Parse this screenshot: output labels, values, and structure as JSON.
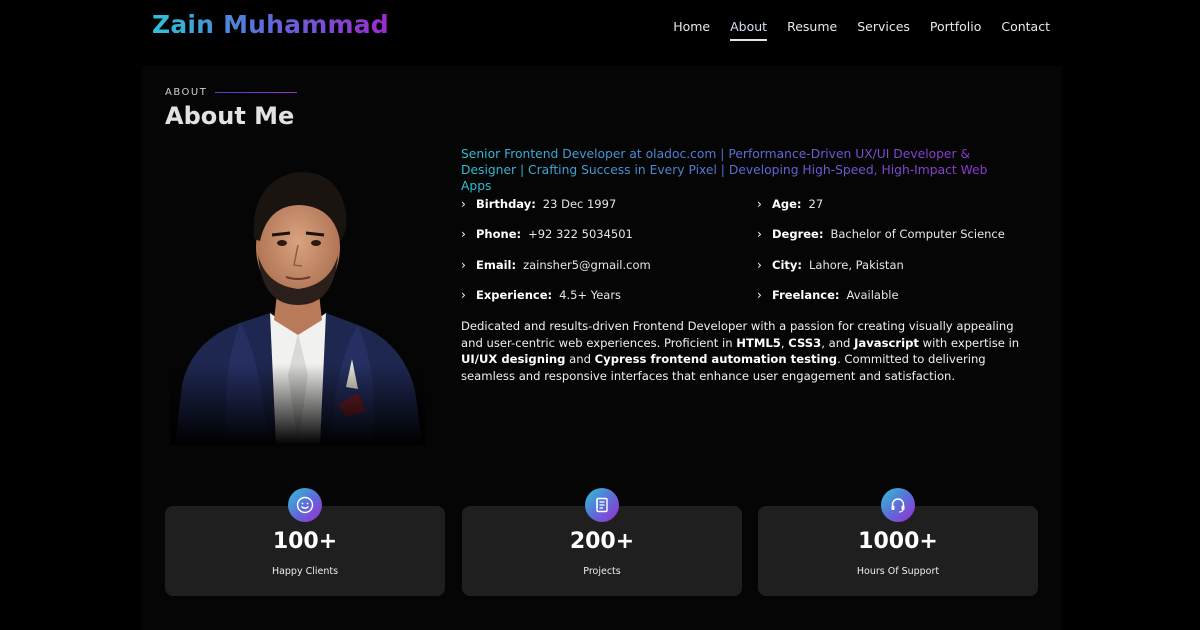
{
  "header": {
    "logo": "Zain Muhammad",
    "nav": [
      "Home",
      "About",
      "Resume",
      "Services",
      "Portfolio",
      "Contact"
    ],
    "active_nav": "About"
  },
  "about": {
    "section_label": "ABOUT",
    "title": "About Me",
    "tagline": "Senior Frontend Developer at oladoc.com | Performance-Driven UX/UI Developer & Designer | Crafting Success in Every Pixel | Developing High-Speed, High-Impact Web Apps",
    "info": [
      {
        "key": "Birthday:",
        "value": "23 Dec 1997"
      },
      {
        "key": "Age:",
        "value": "27"
      },
      {
        "key": "Phone:",
        "value": "+92 322 5034501"
      },
      {
        "key": "Degree:",
        "value": "Bachelor of Computer Science"
      },
      {
        "key": "Email:",
        "value": "zainsher5@gmail.com"
      },
      {
        "key": "City:",
        "value": "Lahore, Pakistan"
      },
      {
        "key": "Experience:",
        "value": "4.5+ Years"
      },
      {
        "key": "Freelance:",
        "value": "Available"
      }
    ],
    "bio": {
      "p1": "Dedicated and results-driven Frontend Developer with a passion for creating visually appealing and user-centric web experiences. Proficient in ",
      "b1": "HTML5",
      "p2": ", ",
      "b2": "CSS3",
      "p3": ", and ",
      "b3": "Javascript",
      "p4": " with expertise in ",
      "b4": "UI/UX designing",
      "p5": " and ",
      "b5": "Cypress frontend automation testing",
      "p6": ". Committed to delivering seamless and responsive interfaces that enhance user engagement and satisfaction."
    }
  },
  "stats": [
    {
      "icon": "smiley-icon",
      "number": "100+",
      "label": "Happy Clients"
    },
    {
      "icon": "journal-icon",
      "number": "200+",
      "label": "Projects"
    },
    {
      "icon": "headset-icon",
      "number": "1000+",
      "label": "Hours Of Support"
    }
  ],
  "colors": {
    "gradient_start": "#2ec4d6",
    "gradient_mid": "#5b6fd8",
    "gradient_end": "#9b2bd0",
    "card_bg": "#1f1f1f"
  }
}
